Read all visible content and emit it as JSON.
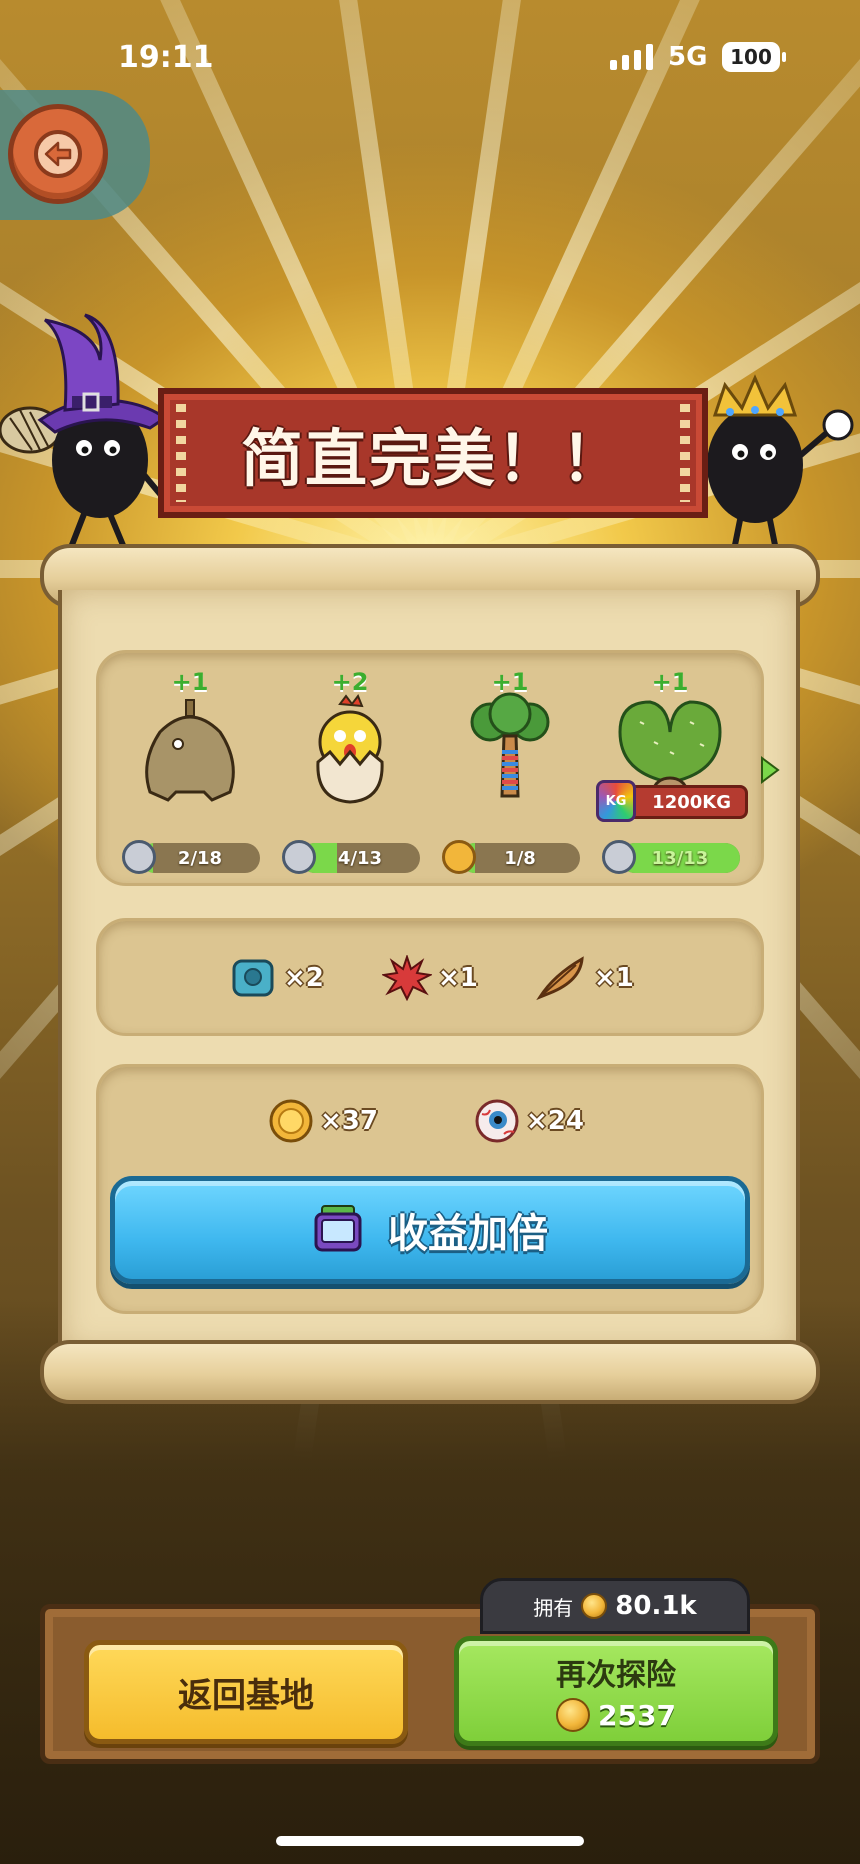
{
  "status_bar": {
    "time": "19:11",
    "network": "5G",
    "battery": "100"
  },
  "banner": {
    "title": "简直完美！！"
  },
  "creatures": [
    {
      "plus": "+1",
      "progress_text": "2/18",
      "progress": 0.11,
      "icon": "gray-skull-icon"
    },
    {
      "plus": "+2",
      "progress_text": "4/13",
      "progress": 0.31,
      "icon": "gray-skull-icon"
    },
    {
      "plus": "+1",
      "progress_text": "1/8",
      "progress": 0.125,
      "icon": "gold-helmet-icon"
    },
    {
      "plus": "+1",
      "progress_text": "13/13",
      "progress": 1.0,
      "icon": "gray-skull-icon",
      "weight": "1200KG",
      "weight_icon_text": "KG"
    }
  ],
  "materials": [
    {
      "icon": "blue-gear-icon",
      "qty": "×2"
    },
    {
      "icon": "red-spiky-icon",
      "qty": "×1"
    },
    {
      "icon": "feather-icon",
      "qty": "×1"
    }
  ],
  "currency_rewards": [
    {
      "icon": "gold-coin-icon",
      "qty": "×37"
    },
    {
      "icon": "eyeball-icon",
      "qty": "×24"
    }
  ],
  "double_button": {
    "label": "收益加倍"
  },
  "owned": {
    "label": "拥有",
    "value": "80.1k"
  },
  "buttons": {
    "home": "返回基地",
    "again": "再次探险",
    "again_cost": "2537"
  },
  "colors": {
    "banner": "#a8372a",
    "double_button": "#3fb8ef",
    "home_button": "#f5bc2c",
    "again_button": "#7fcf3a"
  }
}
